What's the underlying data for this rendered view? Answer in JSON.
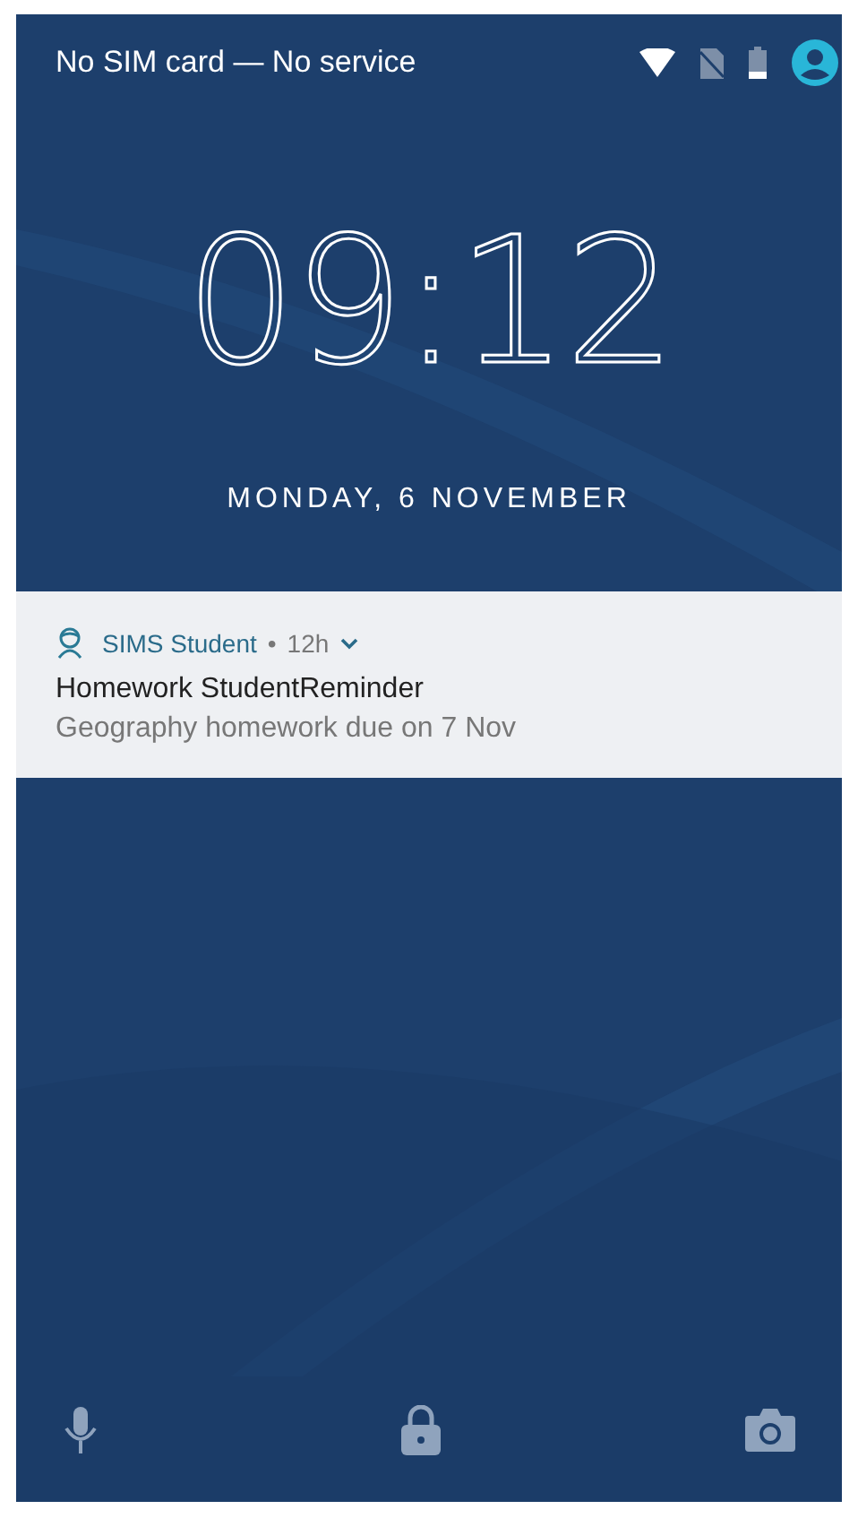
{
  "status_bar": {
    "carrier": "No SIM card — No service"
  },
  "clock": {
    "time": "09:12",
    "date": "MONDAY, 6 NOVEMBER"
  },
  "notifications": [
    {
      "app": "SIMS Student",
      "separator": "•",
      "age": "12h",
      "title": "Homework StudentReminder",
      "text": "Geography homework due on 7 Nov",
      "expanded": false
    }
  ]
}
